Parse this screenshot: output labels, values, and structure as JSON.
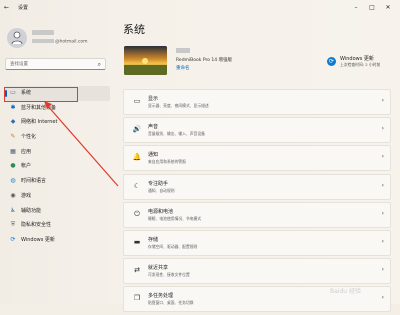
{
  "window": {
    "title": "设置",
    "back_glyph": "←",
    "minimize_glyph": "–",
    "maximize_glyph": "□",
    "close_glyph": "✕"
  },
  "profile": {
    "email_suffix": "@hotmail.com"
  },
  "search": {
    "placeholder": "查找设置",
    "icon": "search-icon"
  },
  "nav": [
    {
      "label": "系统",
      "icon": "display-icon",
      "glyph": "▭",
      "color": "#2b6cb0"
    },
    {
      "label": "蓝牙和其他设备",
      "icon": "bluetooth-icon",
      "glyph": "✱",
      "color": "#0067c0"
    },
    {
      "label": "网络和 Internet",
      "icon": "network-icon",
      "glyph": "◆",
      "color": "#2f6fb3"
    },
    {
      "label": "个性化",
      "icon": "brush-icon",
      "glyph": "✎",
      "color": "#c27a2c"
    },
    {
      "label": "应用",
      "icon": "apps-icon",
      "glyph": "▦",
      "color": "#4a5a70"
    },
    {
      "label": "帐户",
      "icon": "account-icon",
      "glyph": "●",
      "color": "#2e8b57"
    },
    {
      "label": "时间和语言",
      "icon": "globe-icon",
      "glyph": "◍",
      "color": "#1e88c8"
    },
    {
      "label": "游戏",
      "icon": "gamepad-icon",
      "glyph": "◉",
      "color": "#555"
    },
    {
      "label": "辅助功能",
      "icon": "accessibility-icon",
      "glyph": "♿",
      "color": "#1f5fa8"
    },
    {
      "label": "隐私和安全性",
      "icon": "shield-icon",
      "glyph": "⛨",
      "color": "#6b6b6b"
    },
    {
      "label": "Windows 更新",
      "icon": "update-icon",
      "glyph": "⟳",
      "color": "#0f7ad0"
    }
  ],
  "main": {
    "title": "系统",
    "device": {
      "model": "RedmiBook Pro 14 增强版",
      "rename": "重命名"
    },
    "windows_update": {
      "title": "Windows 更新",
      "subtitle": "上次检查时间: 2 小时前",
      "icon": "update-icon"
    },
    "cards": [
      {
        "title": "显示",
        "subtitle": "显示器、亮度、夜间模式、显示描述",
        "icon": "monitor-icon",
        "glyph": "▭"
      },
      {
        "title": "声音",
        "subtitle": "音量级别、输出、输入、声音设备",
        "icon": "speaker-icon",
        "glyph": "🔊"
      },
      {
        "title": "通知",
        "subtitle": "来自应用和系统的警报",
        "icon": "bell-icon",
        "glyph": "🔔"
      },
      {
        "title": "专注助手",
        "subtitle": "通知、自动规则",
        "icon": "moon-icon",
        "glyph": "☾"
      },
      {
        "title": "电源和电池",
        "subtitle": "睡眠、电池使用情况、节电模式",
        "icon": "power-icon",
        "glyph": "⏻"
      },
      {
        "title": "存储",
        "subtitle": "存储空间、驱动器、配置规则",
        "icon": "storage-icon",
        "glyph": "▬"
      },
      {
        "title": "就近共享",
        "subtitle": "可发现性、接收文件位置",
        "icon": "share-icon",
        "glyph": "⇄"
      },
      {
        "title": "多任务处理",
        "subtitle": "贴靠窗口、桌面、任务切换",
        "icon": "multitask-icon",
        "glyph": "❐"
      }
    ],
    "chevron_glyph": "›"
  },
  "accent_color": "#0067c0",
  "annotation_color": "#e23a2e",
  "watermark": "Baidu 经验"
}
